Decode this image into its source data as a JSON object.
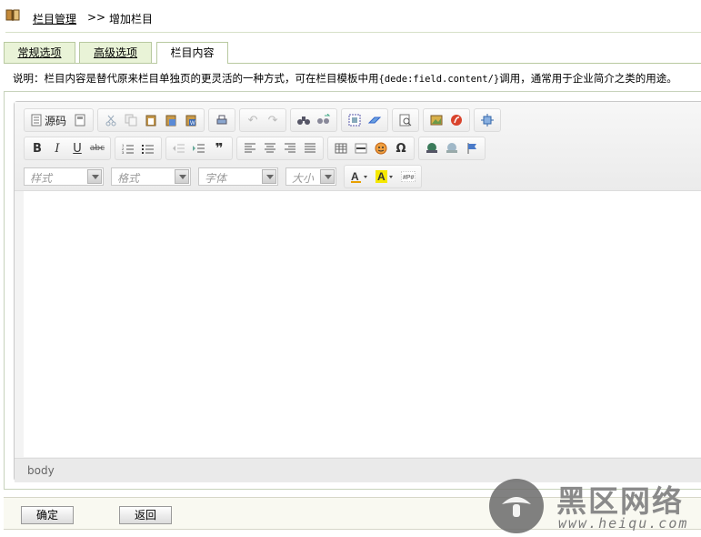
{
  "breadcrumb": {
    "link": "栏目管理",
    "separator": ">>",
    "current": "增加栏目"
  },
  "tabs": [
    {
      "label": "常规选项",
      "active": false
    },
    {
      "label": "高级选项",
      "active": false
    },
    {
      "label": "栏目内容",
      "active": true
    }
  ],
  "note": {
    "prefix": "说明：栏目内容是替代原来栏目单独页的更灵活的一种方式，可在栏目模板中用",
    "code": "{dede:field.content/}",
    "suffix": "调用，通常用于企业简介之类的用途。"
  },
  "editor": {
    "source_label": "源码",
    "combos": {
      "style": "样式",
      "format": "格式",
      "font": "字体",
      "size": "大小"
    },
    "status_path": "body"
  },
  "footer": {
    "ok_label": "确定",
    "back_label": "返回"
  },
  "watermark": {
    "title": "黑区网络",
    "url": "www.heiqu.com"
  },
  "colors": {
    "tab_bg": "#e9f3d7",
    "tab_border": "#b8c9a0",
    "footer_bg": "#f9f9f1"
  }
}
